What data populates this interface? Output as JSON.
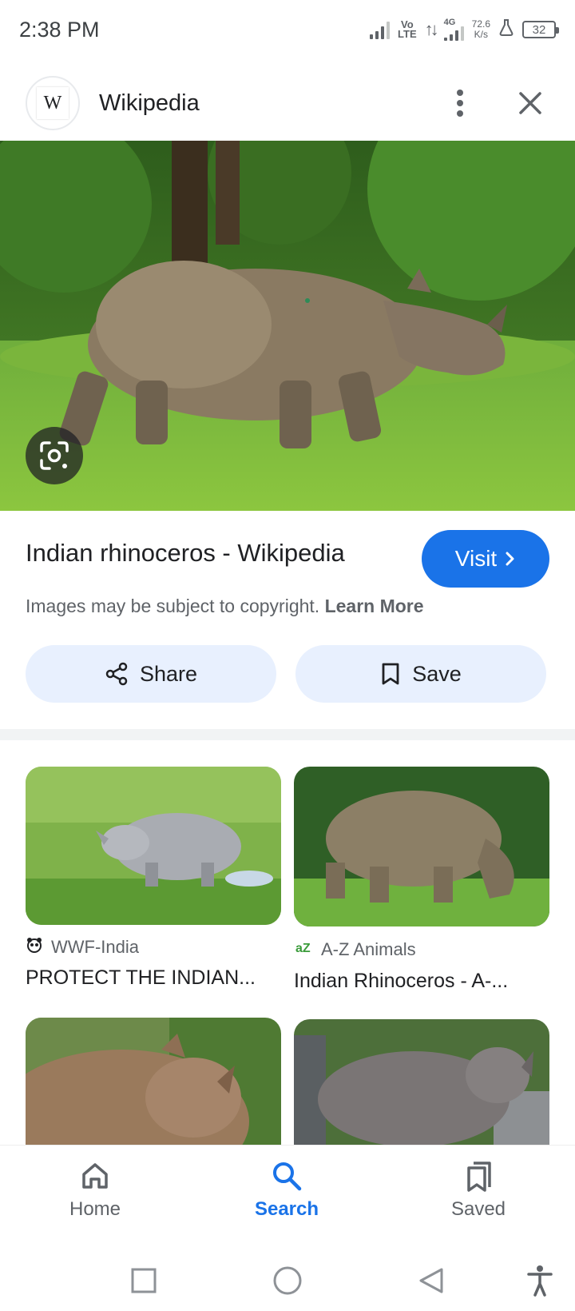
{
  "status_bar": {
    "time": "2:38 PM",
    "volte_line1": "Vo",
    "volte_line2": "LTE",
    "network": "4G",
    "speed_value": "72.6",
    "speed_unit": "K/s",
    "battery": "32"
  },
  "header": {
    "site_icon_letter": "W",
    "site_name": "Wikipedia"
  },
  "hero": {
    "image_icon": "lens-icon"
  },
  "result": {
    "title": "Indian rhinoceros - Wikipedia",
    "visit_label": "Visit",
    "copyright_text": "Images may be subject to copyright.",
    "learn_more": "Learn More",
    "share_label": "Share",
    "save_label": "Save"
  },
  "related": [
    {
      "source": "WWF-India",
      "title": "PROTECT THE INDIAN..."
    },
    {
      "source": "A-Z Animals",
      "title": "Indian Rhinoceros - A-..."
    },
    {
      "source": "",
      "title": ""
    },
    {
      "source": "",
      "title": ""
    }
  ],
  "bottom_nav": {
    "home": "Home",
    "search": "Search",
    "saved": "Saved",
    "active": "Search"
  },
  "colors": {
    "accent": "#1a73e8",
    "chip_bg": "#e8f0fe",
    "text_primary": "#202124",
    "text_secondary": "#5f6368"
  }
}
